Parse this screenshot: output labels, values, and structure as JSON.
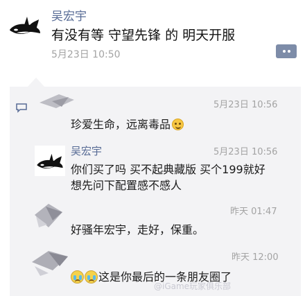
{
  "post": {
    "author": "吴宏宇",
    "text": "有没有等 守望先锋 的 明天开服",
    "time": "5月23日 10:50"
  },
  "comments": [
    {
      "text": "珍爱生命，远离毒品",
      "time": "5月23日 10:56"
    },
    {
      "author": "吴宏宇",
      "line1": "你们买了吗 买不起典藏版 买个199就好",
      "line2": "想先问下配置感不感人",
      "time": "5月23日 10:56"
    },
    {
      "text": "好骚年宏宇，走好，保重。",
      "time": "昨天 01:47"
    },
    {
      "text": "这是你最后的一条朋友圈了",
      "time": "昨天 12:00"
    }
  ],
  "watermark": "@iGame玩家俱乐部",
  "icons": {
    "avatar": "orca-icon",
    "comment_button": "more-dots-icon",
    "comment_marker": "comment-icon",
    "smile_emoji": "smile-icon",
    "cry_emoji": "cry-icon"
  },
  "colors": {
    "name": "#576b95",
    "time": "#a3a3a3",
    "feedback_bg": "#f3f3f5",
    "action_btn": "#7d8ca8"
  }
}
